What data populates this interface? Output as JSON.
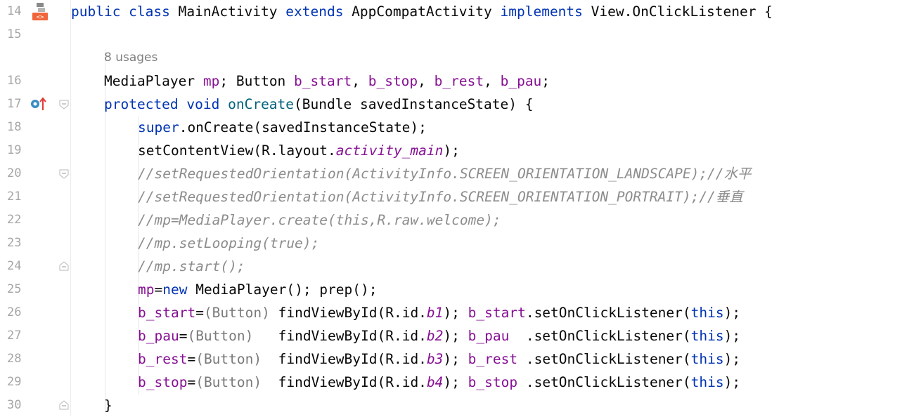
{
  "hint": "8 usages",
  "lines": [
    {
      "num": "14",
      "parts": [
        {
          "t": "public class ",
          "c": "kw"
        },
        {
          "t": "MainActivity ",
          "c": ""
        },
        {
          "t": "extends ",
          "c": "kw"
        },
        {
          "t": "AppCompatActivity ",
          "c": ""
        },
        {
          "t": "implements ",
          "c": "kw"
        },
        {
          "t": "View.OnClickListener {",
          "c": ""
        }
      ]
    },
    {
      "num": "15",
      "parts": []
    },
    {
      "num": "16",
      "parts": [
        {
          "t": "MediaPlayer ",
          "c": ""
        },
        {
          "t": "mp",
          "c": "fld"
        },
        {
          "t": "; Button ",
          "c": ""
        },
        {
          "t": "b_start",
          "c": "fld"
        },
        {
          "t": ", ",
          "c": ""
        },
        {
          "t": "b_stop",
          "c": "fld"
        },
        {
          "t": ", ",
          "c": ""
        },
        {
          "t": "b_rest",
          "c": "fld"
        },
        {
          "t": ", ",
          "c": ""
        },
        {
          "t": "b_pau",
          "c": "fld"
        },
        {
          "t": ";",
          "c": ""
        }
      ]
    },
    {
      "num": "17",
      "parts": [
        {
          "t": "protected void ",
          "c": "kw"
        },
        {
          "t": "onCreate",
          "c": "mth"
        },
        {
          "t": "(Bundle savedInstanceState) {",
          "c": ""
        }
      ]
    },
    {
      "num": "18",
      "parts": [
        {
          "t": "super",
          "c": "kw"
        },
        {
          "t": ".onCreate(savedInstanceState);",
          "c": ""
        }
      ]
    },
    {
      "num": "19",
      "parts": [
        {
          "t": "setContentView(R.layout.",
          "c": ""
        },
        {
          "t": "activity_main",
          "c": "fld-i"
        },
        {
          "t": ");",
          "c": ""
        }
      ]
    },
    {
      "num": "20",
      "parts": [
        {
          "t": "//setRequestedOrientation(ActivityInfo.SCREEN_ORIENTATION_LANDSCAPE);//水平",
          "c": "cmt"
        }
      ]
    },
    {
      "num": "21",
      "parts": [
        {
          "t": "//setRequestedOrientation(ActivityInfo.SCREEN_ORIENTATION_PORTRAIT);//垂直",
          "c": "cmt"
        }
      ]
    },
    {
      "num": "22",
      "parts": [
        {
          "t": "//mp=MediaPlayer.create(this,R.raw.welcome);",
          "c": "cmt"
        }
      ]
    },
    {
      "num": "23",
      "parts": [
        {
          "t": "//mp.setLooping(true);",
          "c": "cmt"
        }
      ]
    },
    {
      "num": "24",
      "parts": [
        {
          "t": "//mp.start();",
          "c": "cmt"
        }
      ]
    },
    {
      "num": "25",
      "parts": [
        {
          "t": "mp",
          "c": "fld"
        },
        {
          "t": "=",
          "c": ""
        },
        {
          "t": "new ",
          "c": "kw"
        },
        {
          "t": "MediaPlayer(); prep();",
          "c": ""
        }
      ]
    },
    {
      "num": "26",
      "parts": [
        {
          "t": "b_start",
          "c": "fld"
        },
        {
          "t": "=",
          "c": ""
        },
        {
          "t": "(Button)",
          "c": "cast"
        },
        {
          "t": " findViewById(R.id.",
          "c": ""
        },
        {
          "t": "b1",
          "c": "fld-i"
        },
        {
          "t": "); ",
          "c": ""
        },
        {
          "t": "b_start",
          "c": "fld"
        },
        {
          "t": ".setOnClickListener(",
          "c": ""
        },
        {
          "t": "this",
          "c": "kw"
        },
        {
          "t": ");",
          "c": ""
        }
      ]
    },
    {
      "num": "27",
      "parts": [
        {
          "t": "b_pau",
          "c": "fld"
        },
        {
          "t": "=",
          "c": ""
        },
        {
          "t": "(Button)",
          "c": "cast"
        },
        {
          "t": "   findViewById(R.id.",
          "c": ""
        },
        {
          "t": "b2",
          "c": "fld-i"
        },
        {
          "t": "); ",
          "c": ""
        },
        {
          "t": "b_pau",
          "c": "fld"
        },
        {
          "t": "  .setOnClickListener(",
          "c": ""
        },
        {
          "t": "this",
          "c": "kw"
        },
        {
          "t": ");",
          "c": ""
        }
      ]
    },
    {
      "num": "28",
      "parts": [
        {
          "t": "b_rest",
          "c": "fld"
        },
        {
          "t": "=",
          "c": ""
        },
        {
          "t": "(Button)",
          "c": "cast"
        },
        {
          "t": "  findViewById(R.id.",
          "c": ""
        },
        {
          "t": "b3",
          "c": "fld-i"
        },
        {
          "t": "); ",
          "c": ""
        },
        {
          "t": "b_rest",
          "c": "fld"
        },
        {
          "t": " .setOnClickListener(",
          "c": ""
        },
        {
          "t": "this",
          "c": "kw"
        },
        {
          "t": ");",
          "c": ""
        }
      ]
    },
    {
      "num": "29",
      "parts": [
        {
          "t": "b_stop",
          "c": "fld"
        },
        {
          "t": "=",
          "c": ""
        },
        {
          "t": "(Button)",
          "c": "cast"
        },
        {
          "t": "  findViewById(R.id.",
          "c": ""
        },
        {
          "t": "b4",
          "c": "fld-i"
        },
        {
          "t": "); ",
          "c": ""
        },
        {
          "t": "b_stop",
          "c": "fld"
        },
        {
          "t": " .setOnClickListener(",
          "c": ""
        },
        {
          "t": "this",
          "c": "kw"
        },
        {
          "t": ");",
          "c": ""
        }
      ]
    },
    {
      "num": "30",
      "parts": [
        {
          "t": "}",
          "c": ""
        }
      ]
    }
  ],
  "gutter_icons": [
    {
      "line": "14",
      "icon": "class-structure-icon"
    },
    {
      "line": "17",
      "icon": "override-method-icon"
    }
  ]
}
